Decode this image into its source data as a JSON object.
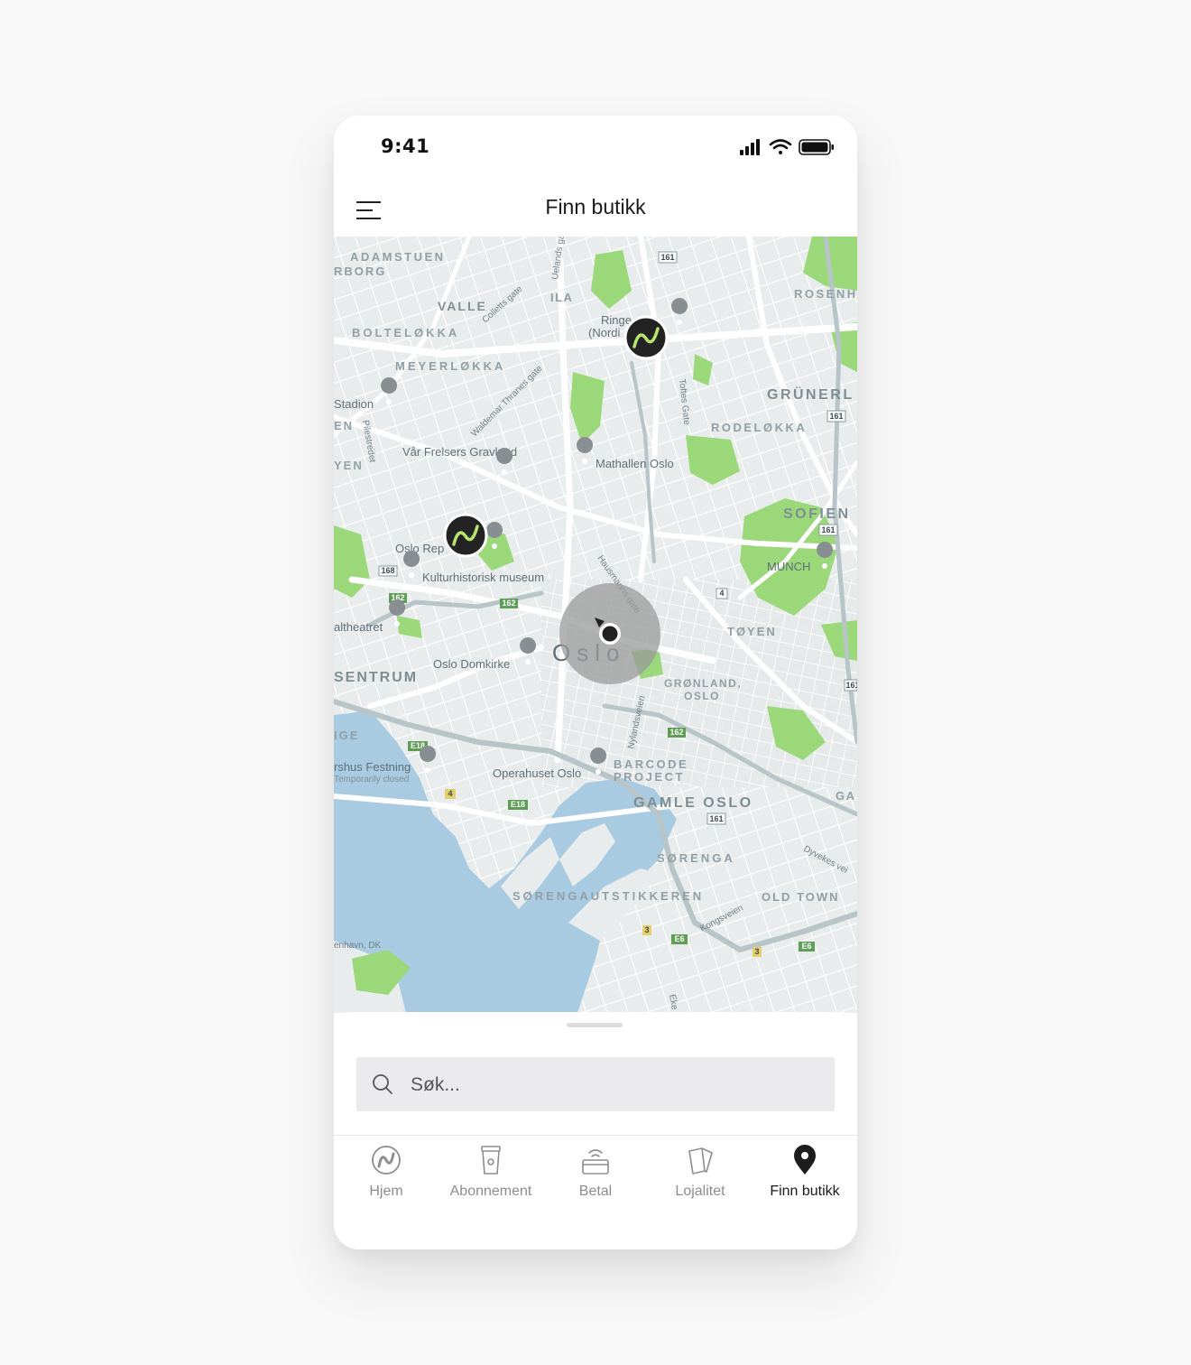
{
  "status_bar": {
    "time": "9:41"
  },
  "header": {
    "title": "Finn butikk"
  },
  "map": {
    "labels": {
      "adamstuen": "ADAMSTUEN",
      "rborg": "RBORG",
      "valle": "VALLE",
      "bolteloekka": "BOLTELØKKA",
      "meyerloekka": "MEYERLØKKA",
      "stadion": "Stadion",
      "en": "EN",
      "yen": "YEN",
      "vaar_frelsers": "Vår Frelsers Gravlund",
      "mathallen": "Mathallen Oslo",
      "ila": "ILA",
      "ringen": "Ringe",
      "nordi": "(Nordi",
      "rosenh": "ROSENH",
      "gruenerl": "GRÜNERL",
      "rodeloekka": "RODELØKKA",
      "sofien": "SOFIEN",
      "munch": "MUNCH",
      "oslo_rep": "Oslo Rep",
      "kulturhistorisk": "Kulturhistorisk museum",
      "altheatret": "altheatret",
      "oslo": "Oslo",
      "sentrum": "SENTRUM",
      "oslo_domkirke": "Oslo Domkirke",
      "toeyen": "TØYEN",
      "groenland": "GRØNLAND,",
      "groenland2": "OSLO",
      "ige": "IGE",
      "festning": "rshus Festning",
      "temporarily_closed": "Temporarily closed",
      "operahuset": "Operahuset Oslo",
      "barcode": "BARCODE",
      "project": "PROJECT",
      "gamle_oslo": "GAMLE OSLO",
      "soerenga": "SØRENGA",
      "soerengautstikkeren": "SØRENGAUTSTIKKEREN",
      "old_town": "OLD TOWN",
      "enhavn": "enhavn, DK",
      "ga": "GA",
      "colletts_gate": "Colletts gate",
      "ullevaal": "Uelands ga",
      "waldemar": "Waldemar Thranes gate",
      "toftes_gate": "Toftes Gate",
      "pilestredet": "Pilestredet",
      "hausmanns": "Hausmanns gate",
      "nylandsveien": "Nylandsveien",
      "dyvekes": "Dyvekes vei",
      "kongsveien": "Kongsveien",
      "ekeb": "Eke"
    },
    "road_shields": {
      "r161a": "161",
      "r161b": "161",
      "r161c": "161",
      "r161d": "161",
      "r161e": "161",
      "r162a": "162",
      "r162b": "162",
      "r162c": "162",
      "r168": "168",
      "r4a": "4",
      "r4b": "4",
      "e18a": "E18",
      "e18b": "E18",
      "e6a": "E6",
      "e6b": "E6",
      "r3a": "3",
      "r3b": "3"
    },
    "store_marker_letter": "N",
    "colors": {
      "land": "#e9ecec",
      "water": "#a9cbe1",
      "park": "#9bd87a",
      "road": "#ffffff",
      "marker": "#232323",
      "accent_green": "#b7e56b"
    }
  },
  "search": {
    "placeholder": "Søk..."
  },
  "tabbar": {
    "items": [
      {
        "label": "Hjem",
        "icon": "brand-logo-icon"
      },
      {
        "label": "Abonnement",
        "icon": "cup-icon"
      },
      {
        "label": "Betal",
        "icon": "contactless-card-icon"
      },
      {
        "label": "Lojalitet",
        "icon": "cards-icon"
      },
      {
        "label": "Finn butikk",
        "icon": "location-pin-icon"
      }
    ],
    "active_index": 4
  }
}
